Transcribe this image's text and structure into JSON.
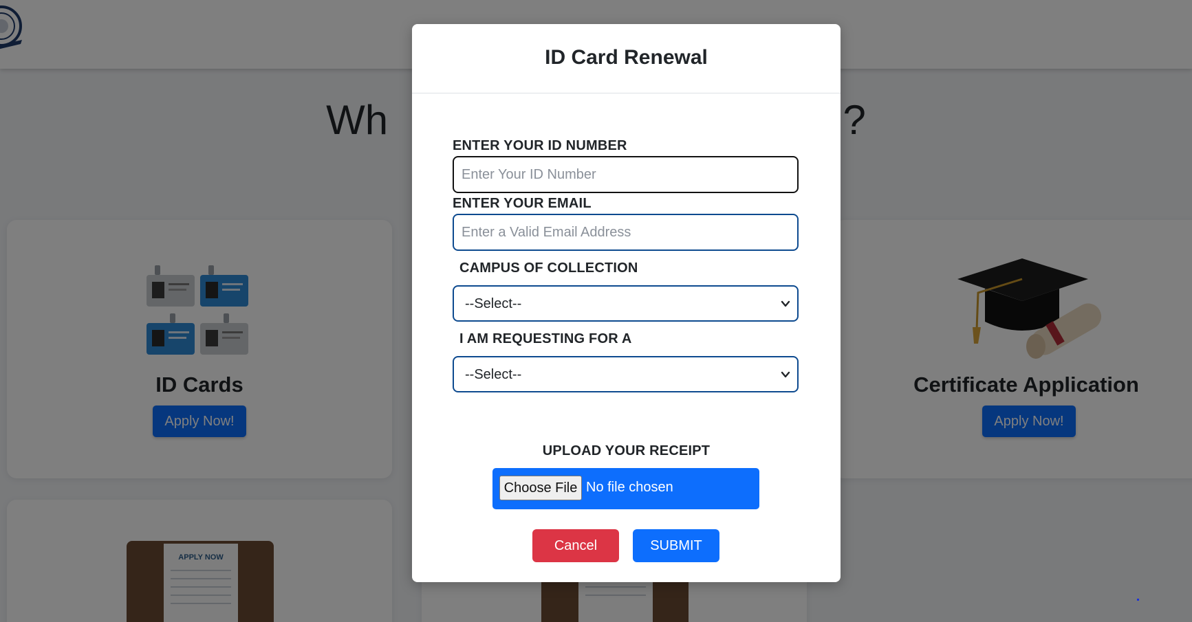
{
  "page": {
    "heading_left": "Wh",
    "heading_right": "n?"
  },
  "cards": [
    {
      "title": "ID Cards",
      "button": "Apply Now!",
      "image_icon": "id-cards-icon"
    },
    {
      "title": "",
      "button": "",
      "image_icon": ""
    },
    {
      "title": "Certificate Application",
      "button": "Apply Now!",
      "image_icon": "graduation-cap-icon"
    }
  ],
  "card_images": {
    "apply_now_text": "APPLY NOW"
  },
  "modal": {
    "title": "ID Card Renewal",
    "id_number": {
      "label": "ENTER YOUR ID NUMBER",
      "placeholder": "Enter Your ID Number",
      "value": ""
    },
    "email": {
      "label": "ENTER YOUR EMAIL",
      "placeholder": "Enter a Valid Email Address",
      "value": ""
    },
    "campus": {
      "label": "CAMPUS OF COLLECTION",
      "selected": "--Select--"
    },
    "request_type": {
      "label": "I AM REQUESTING FOR A",
      "selected": "--Select--"
    },
    "upload": {
      "label": "UPLOAD YOUR RECEIPT",
      "button": "Choose File",
      "status": "No file chosen"
    },
    "cancel_label": "Cancel",
    "submit_label": "SUBMIT"
  },
  "colors": {
    "primary": "#0d6efd",
    "danger": "#dc3545",
    "input_border": "#0d4a8f"
  }
}
